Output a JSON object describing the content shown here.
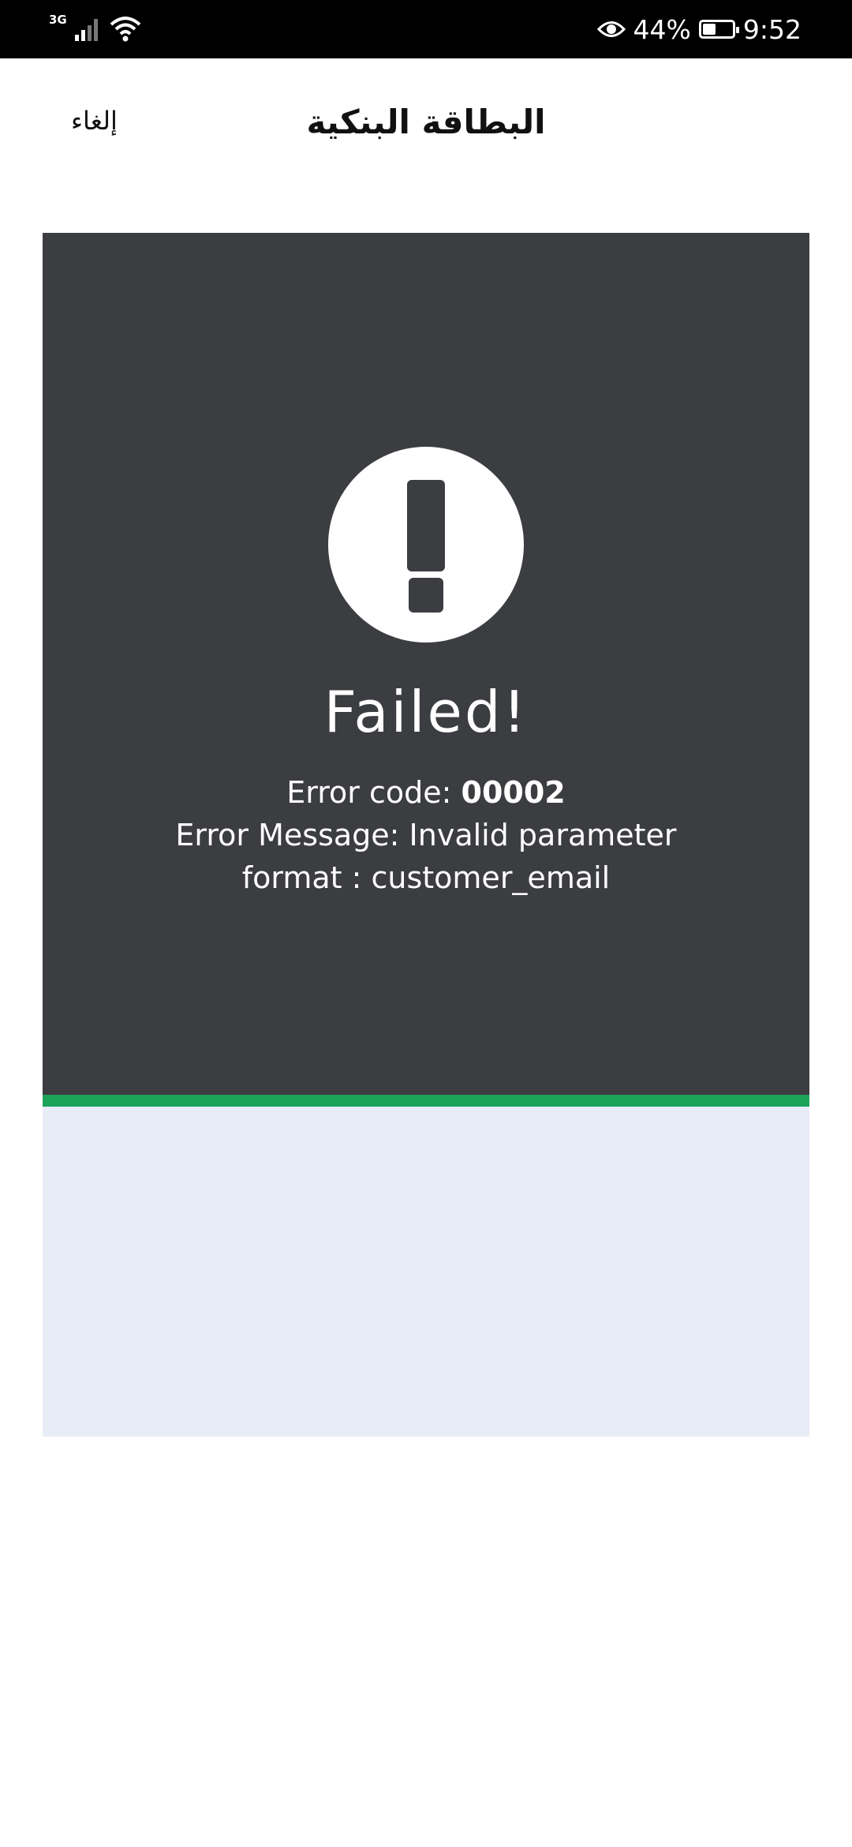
{
  "status_bar": {
    "network_type": "3G",
    "battery_percent": "44%",
    "battery_level": 0.44,
    "time": "9:52",
    "icons": [
      "signal-icon",
      "wifi-icon",
      "eye-icon",
      "battery-icon"
    ]
  },
  "header": {
    "cancel_label": "إلغاء",
    "title": "البطاقة البنكية"
  },
  "result": {
    "title": "Failed!",
    "error_code_label": "Error code: ",
    "error_code": "00002",
    "message_line1": "Error Message: Invalid parameter",
    "message_line2": "format : customer_email"
  },
  "colors": {
    "panel": "#3c3d41",
    "accent_line": "#1da35a",
    "lower_area": "#e7ecf6"
  }
}
